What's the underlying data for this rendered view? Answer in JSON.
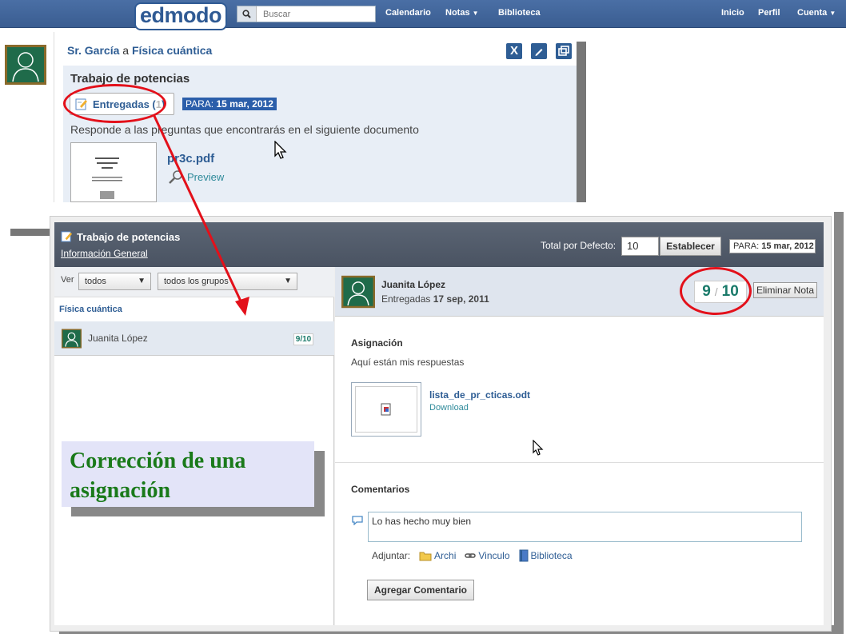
{
  "nav": {
    "logo": "edmodo",
    "search_placeholder": "Buscar",
    "links": {
      "calendario": "Calendario",
      "notas": "Notas",
      "biblioteca": "Biblioteca",
      "inicio": "Inicio",
      "perfil": "Perfil",
      "cuenta": "Cuenta"
    }
  },
  "post": {
    "author": "Sr. García",
    "connector": "a",
    "group": "Física cuántica",
    "title": "Trabajo de potencias",
    "entregadas_label": "Entregadas (",
    "entregadas_count": "1",
    "entregadas_close": ")",
    "due_label": "PARA:",
    "due_date": "15 mar, 2012",
    "description": "Responde a las preguntas que encontrarás en el siguiente documento",
    "file_name": "pr3c.pdf",
    "preview_label": "Preview",
    "actions": [
      "close-icon",
      "edit-icon",
      "expand-icon"
    ]
  },
  "grading": {
    "title": "Trabajo de potencias",
    "subtitle": "Información General",
    "total_label": "Total por Defecto:",
    "total_value": "10",
    "set_button": "Establecer",
    "due_label": "PARA:",
    "due_date": "15 mar, 2012",
    "filter": {
      "ver_label": "Ver",
      "view_selected": "todos",
      "group_selected": "todos los grupos"
    },
    "group_name": "Física cuántica",
    "students": [
      {
        "name": "Juanita López",
        "grade": "9/10"
      }
    ],
    "submission": {
      "student": "Juanita López",
      "status_label": "Entregadas",
      "status_date": "17 sep, 2011",
      "score": "9",
      "max": "10",
      "delete_button": "Eliminar Nota",
      "assignment_heading": "Asignación",
      "assignment_text": "Aquí están mis respuestas",
      "file_name": "lista_de_pr_cticas.odt",
      "download_label": "Download"
    },
    "comments": {
      "heading": "Comentarios",
      "value": "Lo has hecho muy bien",
      "attach_label": "Adjuntar:",
      "attach_file": "Archi",
      "attach_link": "Vinculo",
      "attach_library": "Biblioteca",
      "submit_button": "Agregar Comentario"
    }
  },
  "caption": {
    "line1": "Corrección de una",
    "line2": "asignación"
  },
  "colors": {
    "brand": "#3a5d91",
    "annotation": "#e3101a",
    "grade": "#1a7a6a",
    "caption_text": "#1a7a1a"
  }
}
